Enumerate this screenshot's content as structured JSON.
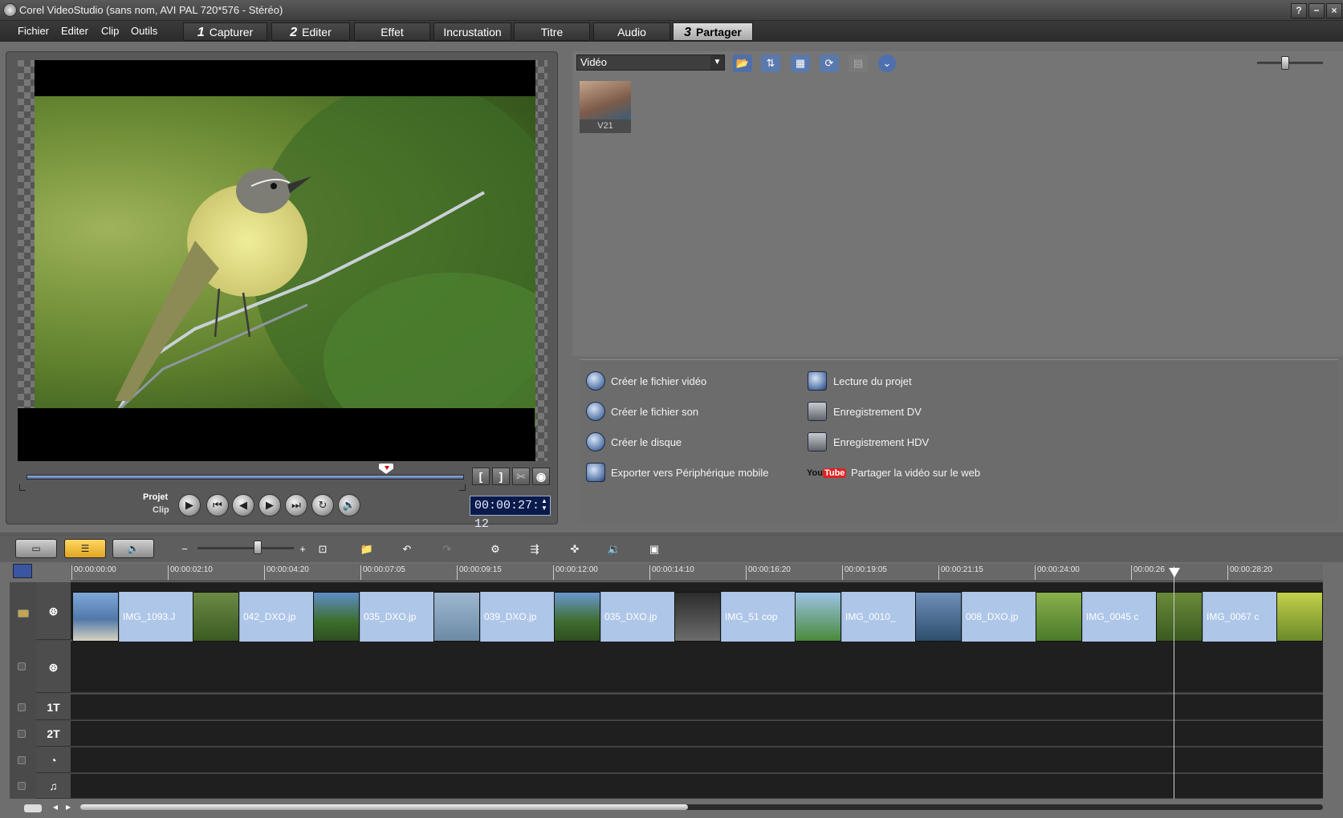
{
  "window": {
    "title": "Corel VideoStudio (sans nom, AVI PAL 720*576 - Stéréo)",
    "help": "?",
    "minimize": "−",
    "close": "×"
  },
  "menu": [
    "Fichier",
    "Editer",
    "Clip",
    "Outils"
  ],
  "tabs": [
    {
      "num": "1",
      "label": "Capturer"
    },
    {
      "num": "2",
      "label": "Editer"
    },
    {
      "num": "",
      "label": "Effet"
    },
    {
      "num": "",
      "label": "Incrustation"
    },
    {
      "num": "",
      "label": "Titre"
    },
    {
      "num": "",
      "label": "Audio"
    },
    {
      "num": "3",
      "label": "Partager"
    }
  ],
  "preview": {
    "mode_project": "Projet",
    "mode_clip": "Clip",
    "timecode": "00:00:27: 12",
    "mark_in": "[",
    "mark_out": "]"
  },
  "library": {
    "category": "Vidéo",
    "thumb_label": "V21"
  },
  "share": {
    "items_left": [
      "Créer le fichier vidéo",
      "Créer le fichier son",
      "Créer le disque",
      "Exporter vers Périphérique mobile"
    ],
    "items_right": [
      "Lecture du projet",
      "Enregistrement DV",
      "Enregistrement HDV",
      "Partager la vidéo sur le web"
    ],
    "youtube_you": "You",
    "youtube_tube": "Tube"
  },
  "timeline": {
    "ruler": [
      "00:00:00:00",
      "00:00:02:10",
      "00:00:04:20",
      "00:00:07:05",
      "00:00:09:15",
      "00:00:12:00",
      "00:00:14:10",
      "00:00:16:20",
      "00:00:19:05",
      "00:00:21:15",
      "00:00:24:00",
      "00:00:26",
      "00:00:28:20"
    ],
    "clips": [
      "IMG_1093.J",
      "042_DXO.jp",
      "035_DXO.jp",
      "039_DXO.jp",
      "035_DXO.jp",
      "IMG_51 cop",
      "IMG_0010_",
      "008_DXO.jp",
      "IMG_0045 c",
      "IMG_0067 c"
    ],
    "track_labels": [
      "",
      "",
      "1T",
      "2T",
      "",
      "♫"
    ]
  }
}
